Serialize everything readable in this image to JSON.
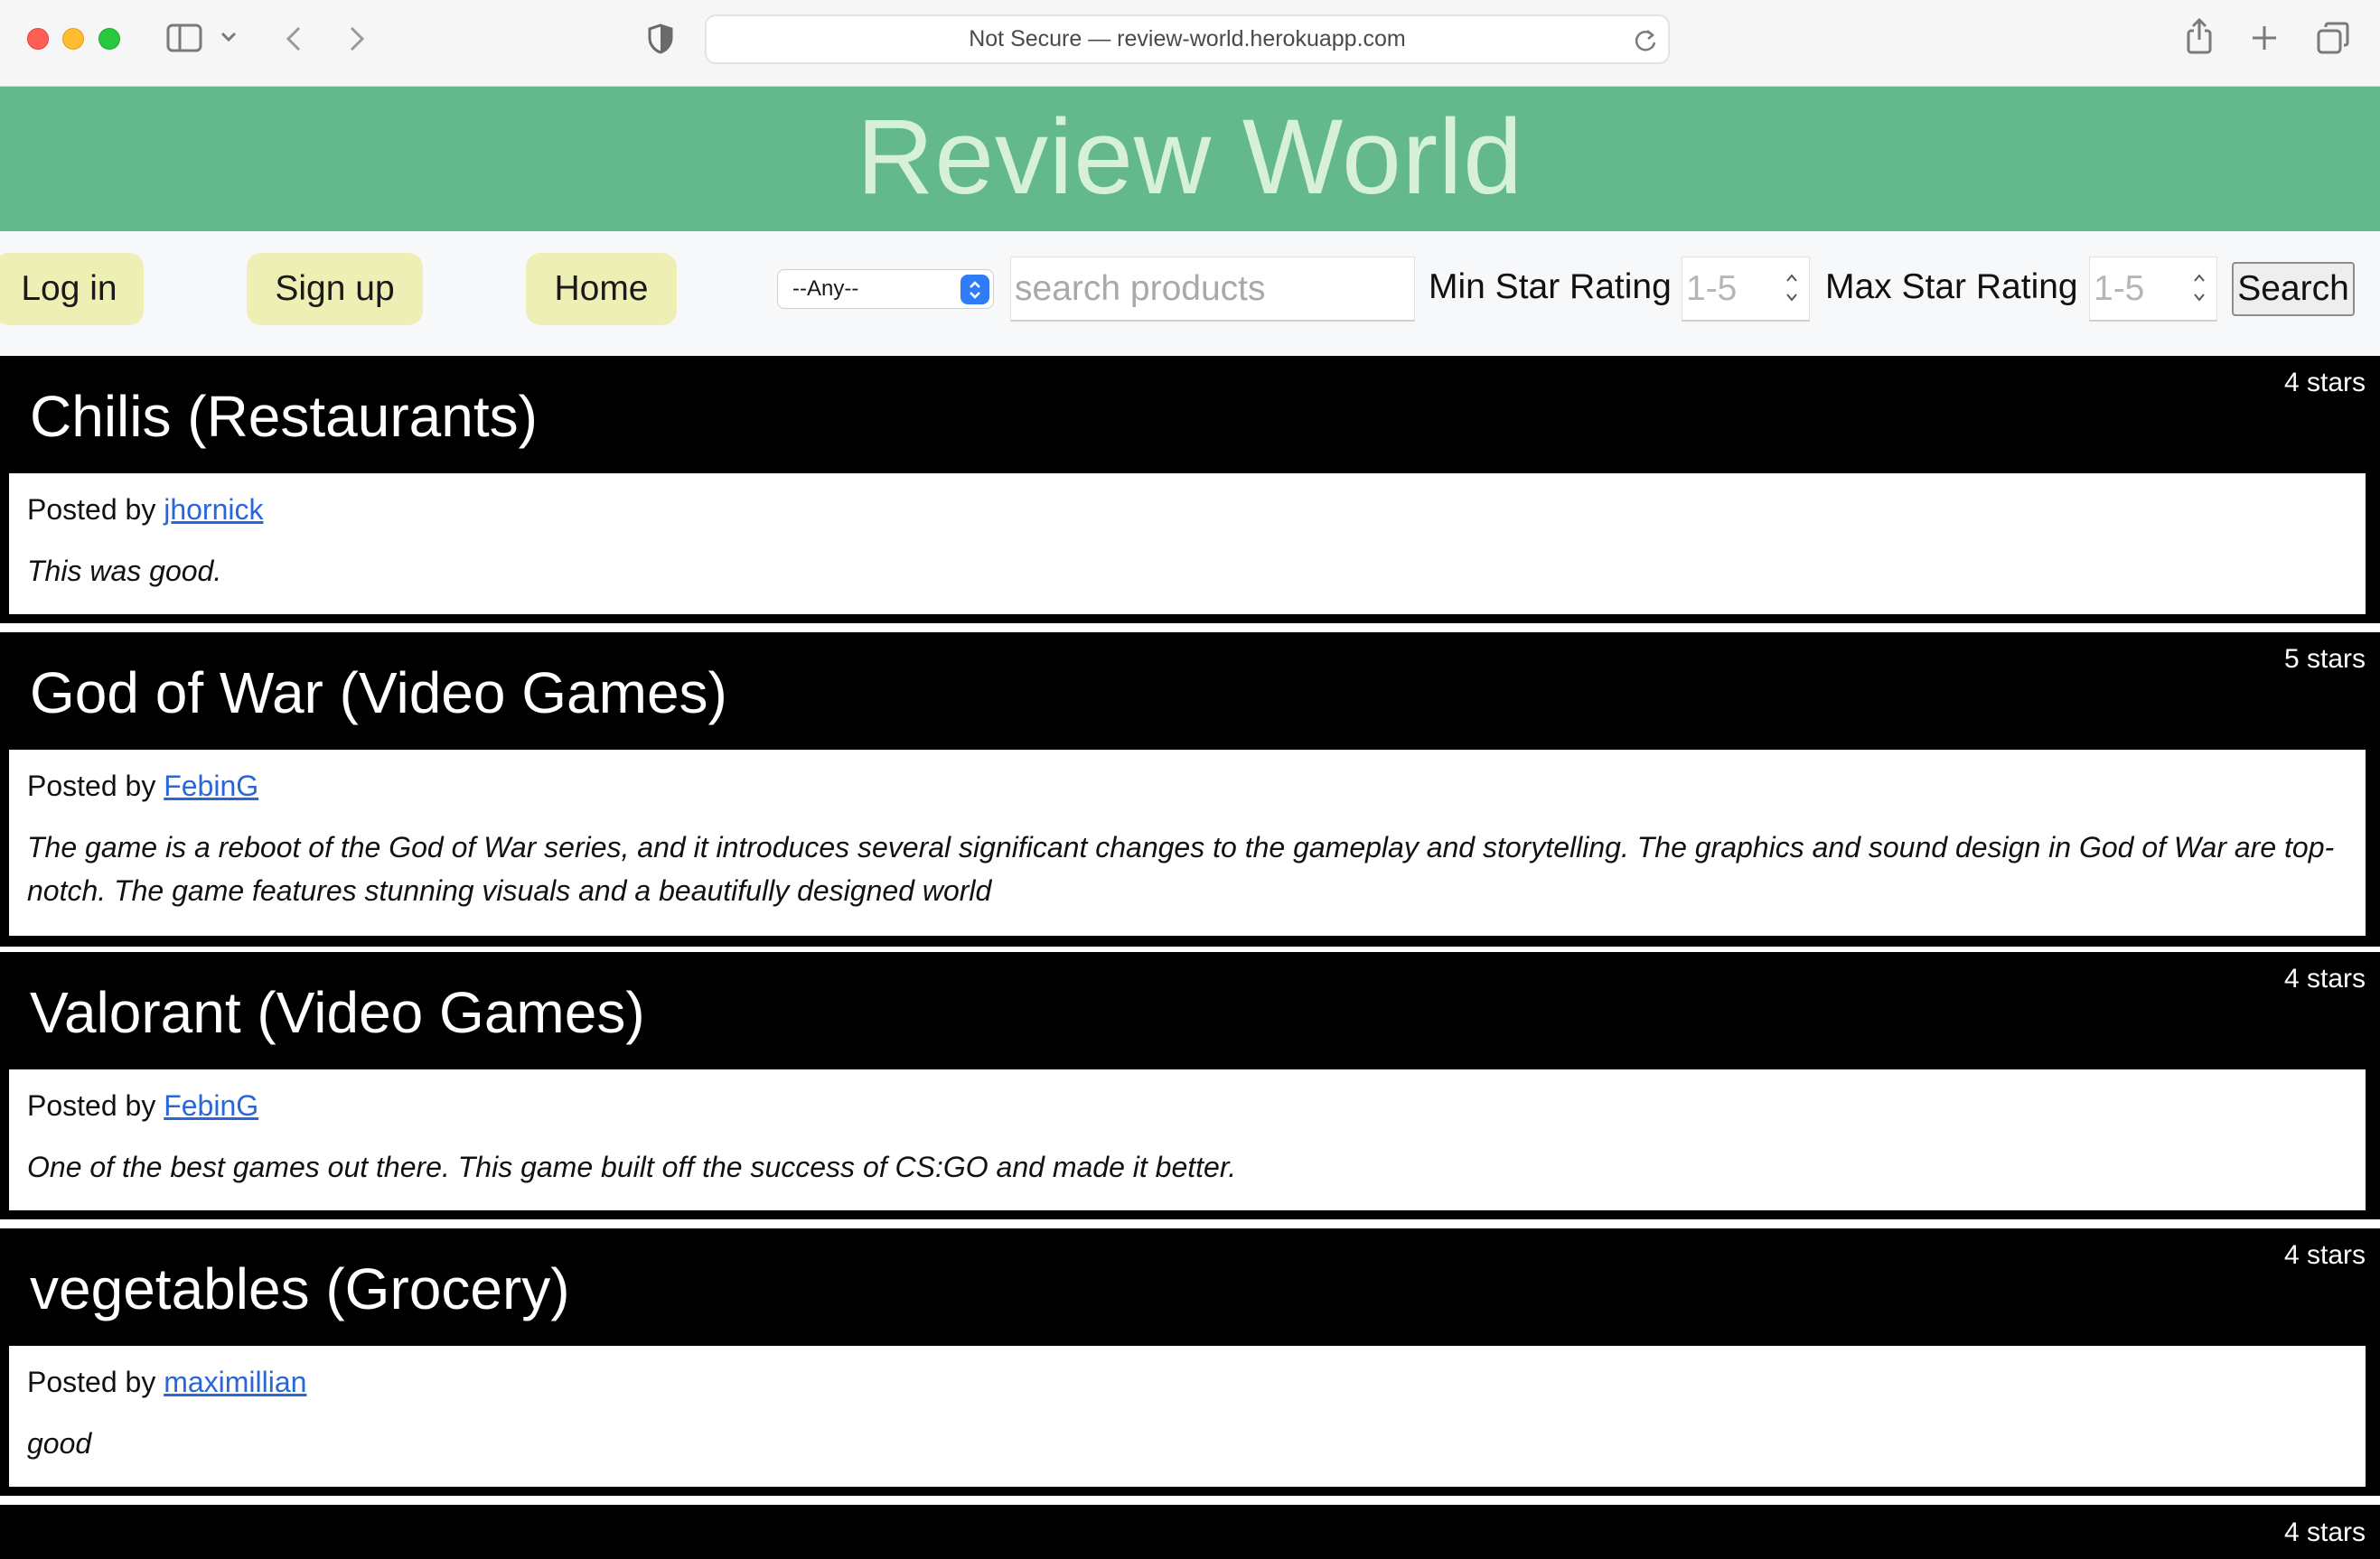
{
  "browser": {
    "url_text": "Not Secure — review-world.herokuapp.com"
  },
  "site": {
    "title": "Review World"
  },
  "nav": {
    "login": "Log in",
    "signup": "Sign up",
    "home": "Home",
    "category_selected": "--Any--",
    "search_placeholder": "search products",
    "min_label": "Min Star Rating",
    "max_label": "Max Star Rating",
    "rating_placeholder": "1-5",
    "search_button": "Search"
  },
  "posted_by_label": "Posted by",
  "reviews": [
    {
      "title": "Chilis (Restaurants)",
      "stars": "4 stars",
      "author": "jhornick",
      "text": "This was good."
    },
    {
      "title": "God of War (Video Games)",
      "stars": "5 stars",
      "author": "FebinG",
      "text": "The game is a reboot of the God of War series, and it introduces several significant changes to the gameplay and storytelling. The graphics and sound design in God of War are top-notch. The game features stunning visuals and a beautifully designed world"
    },
    {
      "title": "Valorant (Video Games)",
      "stars": "4 stars",
      "author": "FebinG",
      "text": "One of the best games out there. This game built off the success of CS:GO and made it better."
    },
    {
      "title": "vegetables (Grocery)",
      "stars": "4 stars",
      "author": "maximillian",
      "text": "good"
    },
    {
      "title": "",
      "stars": "4 stars",
      "author": "",
      "text": ""
    }
  ],
  "colors": {
    "header_bg": "#63b88e",
    "title_text": "#d6f1d8",
    "nav_button_bg": "#eeefb4",
    "review_bg": "#000000",
    "link": "#2a66d8"
  }
}
